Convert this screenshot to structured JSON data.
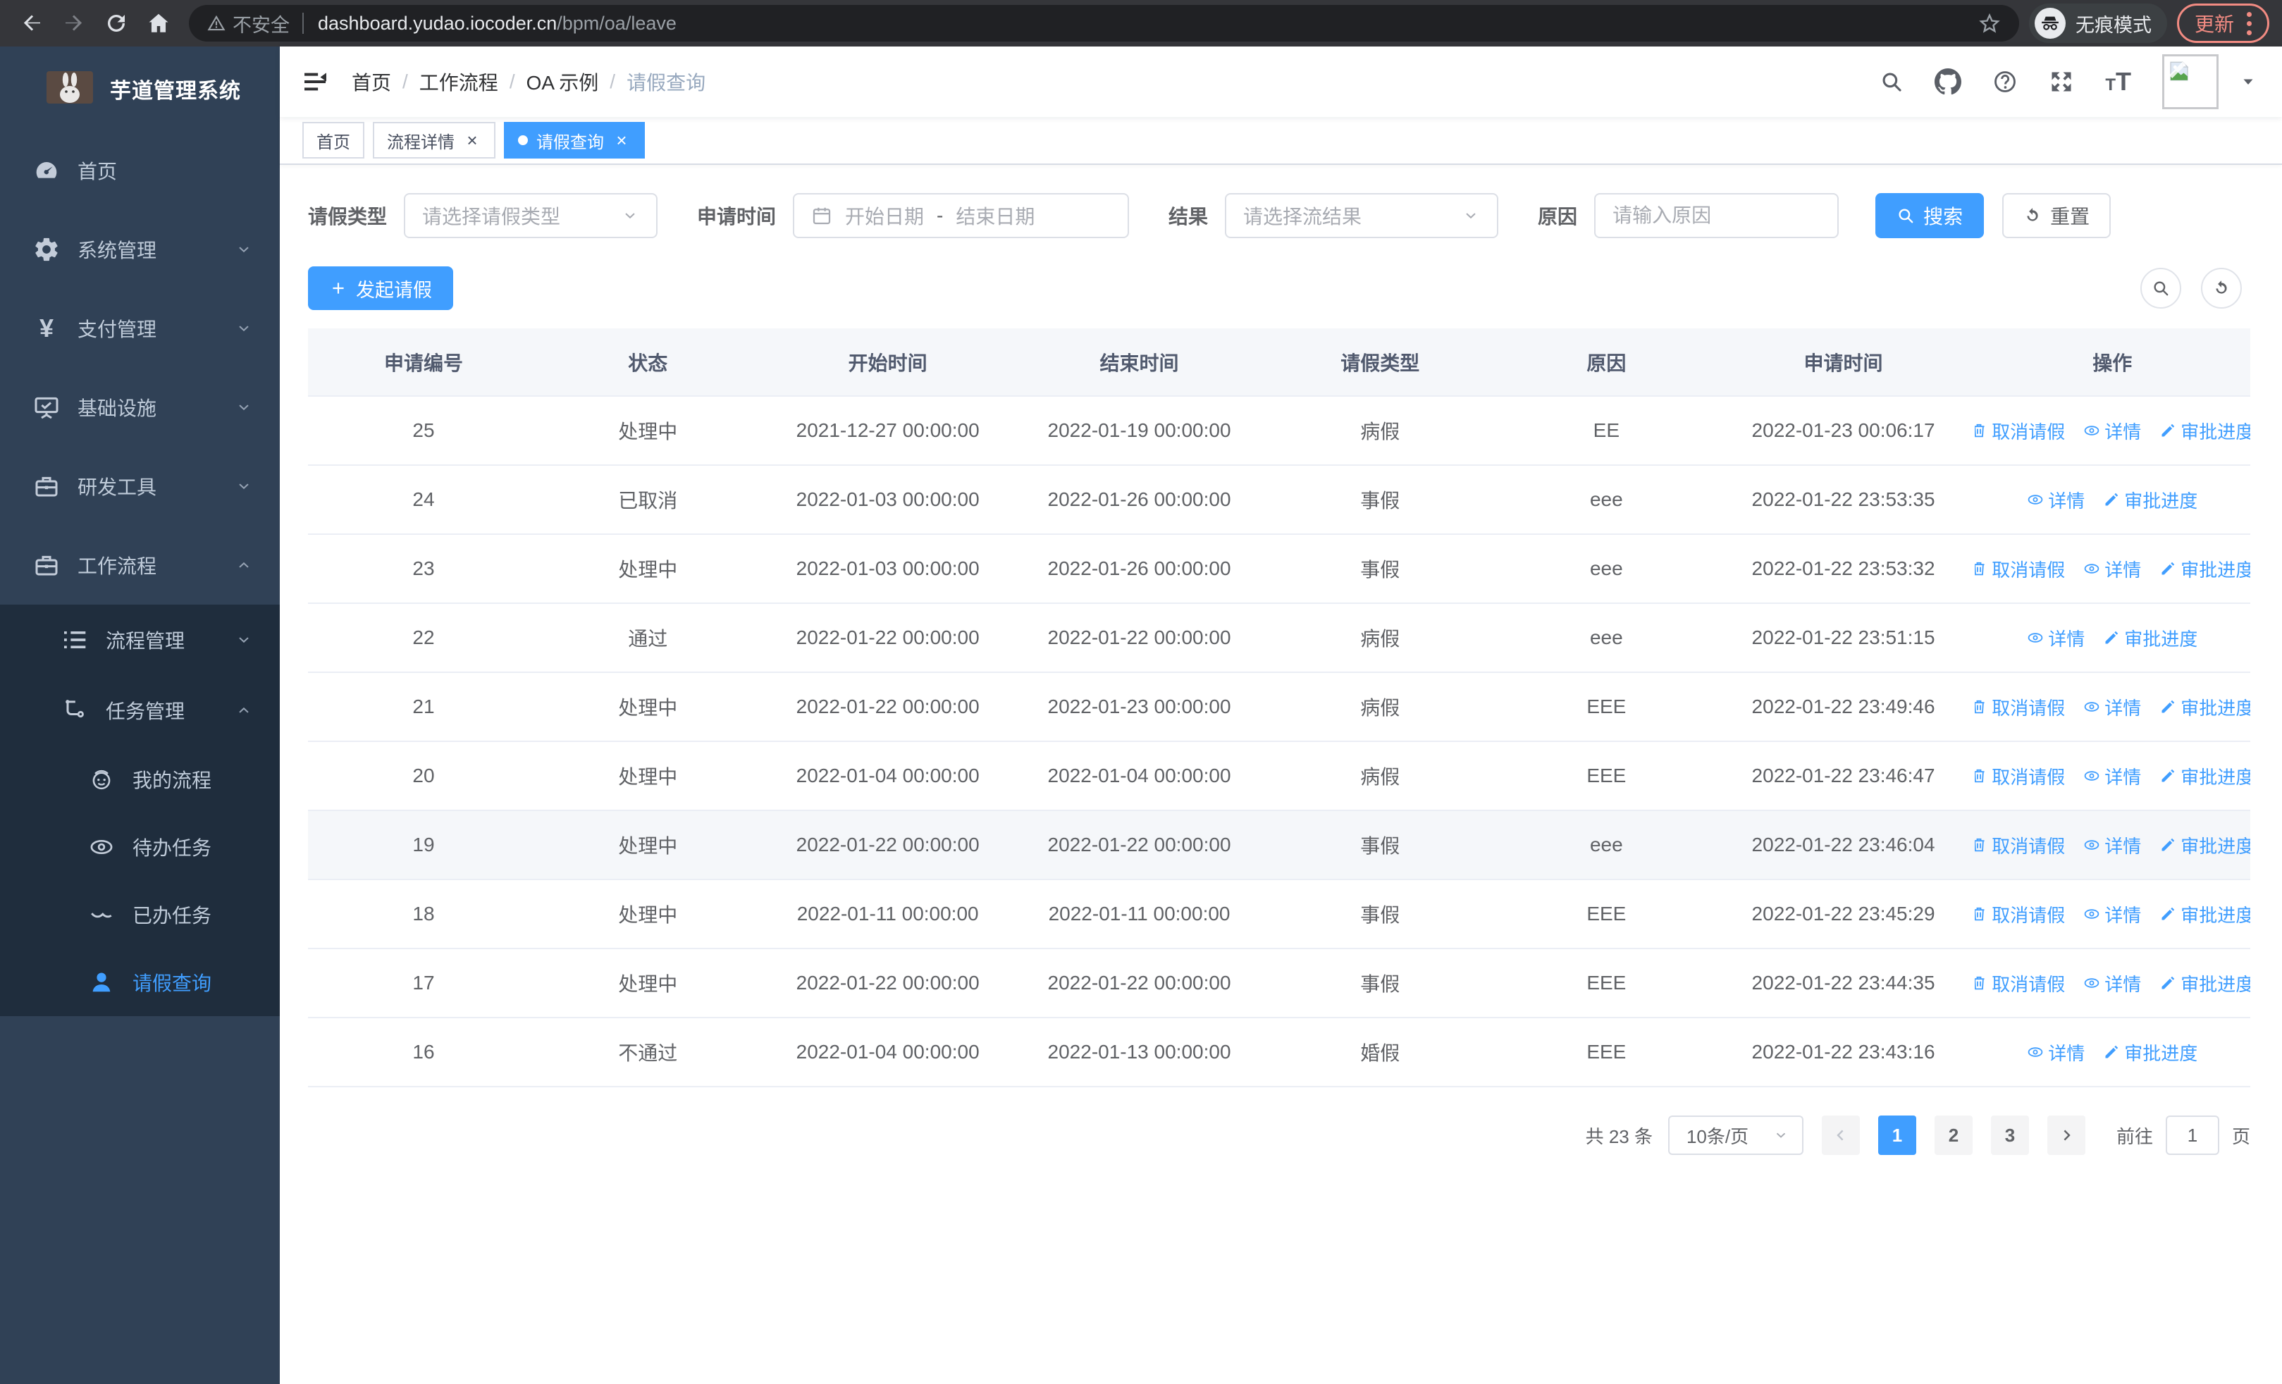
{
  "browser": {
    "security_label": "不安全",
    "url_host": "dashboard.yudao.iocoder.cn",
    "url_path": "/bpm/oa/leave",
    "incognito_label": "无痕模式",
    "update_label": "更新"
  },
  "sidebar": {
    "title": "芋道管理系统",
    "items": [
      {
        "label": "首页"
      },
      {
        "label": "系统管理"
      },
      {
        "label": "支付管理"
      },
      {
        "label": "基础设施"
      },
      {
        "label": "研发工具"
      },
      {
        "label": "工作流程"
      },
      {
        "label": "流程管理"
      },
      {
        "label": "任务管理"
      },
      {
        "label": "我的流程"
      },
      {
        "label": "待办任务"
      },
      {
        "label": "已办任务"
      },
      {
        "label": "请假查询"
      }
    ]
  },
  "breadcrumb": {
    "items": [
      "首页",
      "工作流程",
      "OA 示例",
      "请假查询"
    ]
  },
  "tabs": [
    {
      "label": "首页"
    },
    {
      "label": "流程详情"
    },
    {
      "label": "请假查询"
    }
  ],
  "filters": {
    "leave_type_label": "请假类型",
    "leave_type_placeholder": "请选择请假类型",
    "apply_time_label": "申请时间",
    "start_placeholder": "开始日期",
    "range_separator": "-",
    "end_placeholder": "结束日期",
    "result_label": "结果",
    "result_placeholder": "请选择流结果",
    "reason_label": "原因",
    "reason_placeholder": "请输入原因",
    "search_label": "搜索",
    "reset_label": "重置"
  },
  "toolbar": {
    "create_label": "发起请假"
  },
  "table": {
    "columns": [
      "申请编号",
      "状态",
      "开始时间",
      "结束时间",
      "请假类型",
      "原因",
      "申请时间",
      "操作"
    ],
    "action_labels": {
      "cancel": "取消请假",
      "detail": "详情",
      "progress": "审批进度"
    },
    "rows": [
      {
        "id": "25",
        "status": "处理中",
        "start_time": "2021-12-27 00:00:00",
        "end_time": "2022-01-19 00:00:00",
        "leave_type": "病假",
        "reason": "EE",
        "apply_time": "2022-01-23 00:06:17",
        "can_cancel": true,
        "highlighted": false
      },
      {
        "id": "24",
        "status": "已取消",
        "start_time": "2022-01-03 00:00:00",
        "end_time": "2022-01-26 00:00:00",
        "leave_type": "事假",
        "reason": "eee",
        "apply_time": "2022-01-22 23:53:35",
        "can_cancel": false,
        "highlighted": false
      },
      {
        "id": "23",
        "status": "处理中",
        "start_time": "2022-01-03 00:00:00",
        "end_time": "2022-01-26 00:00:00",
        "leave_type": "事假",
        "reason": "eee",
        "apply_time": "2022-01-22 23:53:32",
        "can_cancel": true,
        "highlighted": false
      },
      {
        "id": "22",
        "status": "通过",
        "start_time": "2022-01-22 00:00:00",
        "end_time": "2022-01-22 00:00:00",
        "leave_type": "病假",
        "reason": "eee",
        "apply_time": "2022-01-22 23:51:15",
        "can_cancel": false,
        "highlighted": false
      },
      {
        "id": "21",
        "status": "处理中",
        "start_time": "2022-01-22 00:00:00",
        "end_time": "2022-01-23 00:00:00",
        "leave_type": "病假",
        "reason": "EEE",
        "apply_time": "2022-01-22 23:49:46",
        "can_cancel": true,
        "highlighted": false
      },
      {
        "id": "20",
        "status": "处理中",
        "start_time": "2022-01-04 00:00:00",
        "end_time": "2022-01-04 00:00:00",
        "leave_type": "病假",
        "reason": "EEE",
        "apply_time": "2022-01-22 23:46:47",
        "can_cancel": true,
        "highlighted": false
      },
      {
        "id": "19",
        "status": "处理中",
        "start_time": "2022-01-22 00:00:00",
        "end_time": "2022-01-22 00:00:00",
        "leave_type": "事假",
        "reason": "eee",
        "apply_time": "2022-01-22 23:46:04",
        "can_cancel": true,
        "highlighted": true
      },
      {
        "id": "18",
        "status": "处理中",
        "start_time": "2022-01-11 00:00:00",
        "end_time": "2022-01-11 00:00:00",
        "leave_type": "事假",
        "reason": "EEE",
        "apply_time": "2022-01-22 23:45:29",
        "can_cancel": true,
        "highlighted": false
      },
      {
        "id": "17",
        "status": "处理中",
        "start_time": "2022-01-22 00:00:00",
        "end_time": "2022-01-22 00:00:00",
        "leave_type": "事假",
        "reason": "EEE",
        "apply_time": "2022-01-22 23:44:35",
        "can_cancel": true,
        "highlighted": false
      },
      {
        "id": "16",
        "status": "不通过",
        "start_time": "2022-01-04 00:00:00",
        "end_time": "2022-01-13 00:00:00",
        "leave_type": "婚假",
        "reason": "EEE",
        "apply_time": "2022-01-22 23:43:16",
        "can_cancel": false,
        "highlighted": false
      }
    ]
  },
  "pagination": {
    "total_label": "共 23 条",
    "page_size_label": "10条/页",
    "pages": [
      "1",
      "2",
      "3"
    ],
    "active_page": "1",
    "goto_label": "前往",
    "goto_value": "1",
    "page_unit_label": "页"
  },
  "colors": {
    "accent": "#409eff",
    "sidebar_bg": "#304156",
    "submenu_bg": "#1f2d3d",
    "update_chip": "#f28b82"
  }
}
